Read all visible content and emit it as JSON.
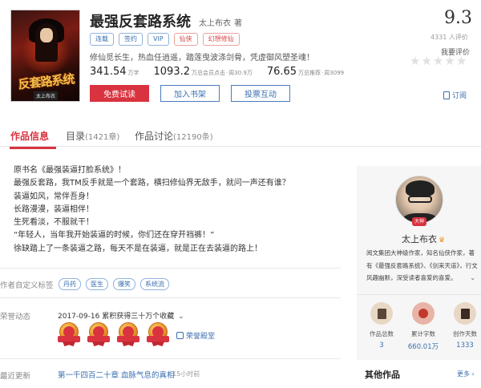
{
  "book": {
    "title": "最强反套路系统",
    "author": "太上布衣",
    "author_suffix": "著",
    "tags": [
      {
        "label": "连载",
        "color": "blue"
      },
      {
        "label": "签约",
        "color": "blue"
      },
      {
        "label": "VIP",
        "color": "blue"
      },
      {
        "label": "仙侠",
        "color": "red"
      },
      {
        "label": "幻想修仙",
        "color": "red"
      }
    ],
    "intro": "修仙觅长生，热血任逍遥，踏莲曳波涤剑骨，凭虚御风塑圣魂！",
    "stats": [
      {
        "num": "341.54",
        "unit": "万字",
        "sub": ""
      },
      {
        "num": "1093.2",
        "unit": "万总会员点击",
        "sub": "周30.9万"
      },
      {
        "num": "76.65",
        "unit": "万总推荐",
        "sub": "周3099"
      }
    ],
    "cover_title": "反套路系统",
    "cover_author": "太上布衣"
  },
  "buttons": {
    "free_read": "免费试读",
    "add_shelf": "加入书架",
    "vote": "投票互动"
  },
  "score": {
    "value": "9.3",
    "count": "4331 人评价",
    "rate_label": "我要评价",
    "subscribe": "订阅"
  },
  "tabs": [
    {
      "label": "作品信息",
      "count": ""
    },
    {
      "label": "目录",
      "count": "(1421章)"
    },
    {
      "label": "作品讨论",
      "count": "(12190条)"
    }
  ],
  "synopsis": [
    "原书名《最强装逼打脸系统》！",
    "最强反套路，我TM反手就是一个套路，横扫修仙界无敌手，就问一声还有谁？",
    "装逼如风，常伴吾身！",
    "长路漫漫，装逼相伴！",
    "生死看淡，不服就干！",
    "“年轻人，当年我开始装逼的时候，你们还在穿开裆裤！”",
    "徐缺踏上了一条装逼之路，每天不是在装逼，就是正在去装逼的路上！"
  ],
  "custom_tags": {
    "label": "作者自定义标签",
    "items": [
      "丹药",
      "医生",
      "爆笑",
      "系统流"
    ]
  },
  "honor": {
    "label": "荣誉动态",
    "date": "2017-09-16",
    "text": "累积获得三十万个收藏",
    "chevron": "⌄",
    "link": "荣誉殿堂"
  },
  "update": {
    "label": "最近更新",
    "chapter": "第一千四百二十章 血脉气息的真相",
    "time": "· 15小时前"
  },
  "author_card": {
    "name": "太上布衣",
    "badge": "大神",
    "bio": "阅文集团大神级作家，知名仙侠作家，著有《最强反套路系统》、《剑来天道》，行文风趣幽默，深受读者喜爱的喜爱。",
    "stats": [
      {
        "label": "作品总数",
        "value": "3"
      },
      {
        "label": "累计字数",
        "value": "660.01万"
      },
      {
        "label": "创作天数",
        "value": "1333"
      }
    ]
  },
  "other_works": {
    "title": "其他作品",
    "more": "更多 ›"
  }
}
